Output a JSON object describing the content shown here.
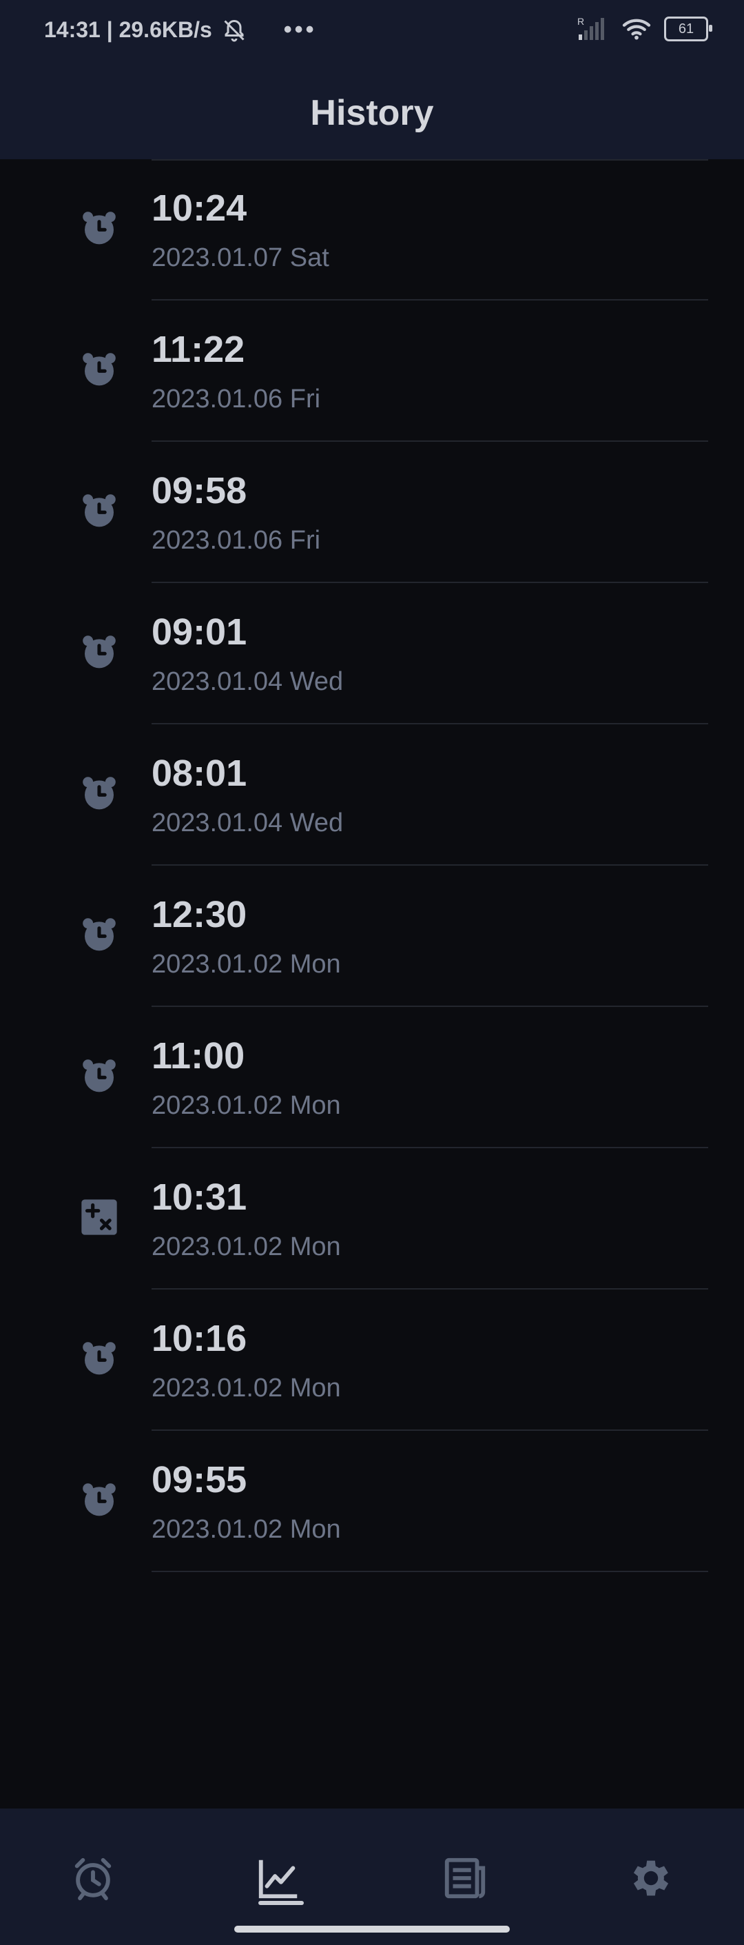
{
  "status": {
    "time_speed": "14:31 | 29.6KB/s",
    "battery": "61",
    "signal_label": "R"
  },
  "appbar": {
    "title": "History"
  },
  "history": [
    {
      "time": "10:24",
      "date": "2023.01.07 Sat",
      "icon": "alarm-clock-icon"
    },
    {
      "time": "11:22",
      "date": "2023.01.06 Fri",
      "icon": "alarm-clock-icon"
    },
    {
      "time": "09:58",
      "date": "2023.01.06 Fri",
      "icon": "alarm-clock-icon"
    },
    {
      "time": "09:01",
      "date": "2023.01.04 Wed",
      "icon": "alarm-clock-icon"
    },
    {
      "time": "08:01",
      "date": "2023.01.04 Wed",
      "icon": "alarm-clock-icon"
    },
    {
      "time": "12:30",
      "date": "2023.01.02 Mon",
      "icon": "alarm-clock-icon"
    },
    {
      "time": "11:00",
      "date": "2023.01.02 Mon",
      "icon": "alarm-clock-icon"
    },
    {
      "time": "10:31",
      "date": "2023.01.02 Mon",
      "icon": "calculator-icon"
    },
    {
      "time": "10:16",
      "date": "2023.01.02 Mon",
      "icon": "alarm-clock-icon"
    },
    {
      "time": "09:55",
      "date": "2023.01.02 Mon",
      "icon": "alarm-clock-icon"
    }
  ],
  "nav": [
    {
      "icon": "alarm-icon"
    },
    {
      "icon": "chart-icon",
      "selected": true
    },
    {
      "icon": "news-icon"
    },
    {
      "icon": "gear-icon"
    }
  ],
  "colors": {
    "background": "#0b0c10",
    "bar": "#151a2c",
    "icon": "#5a6478"
  }
}
